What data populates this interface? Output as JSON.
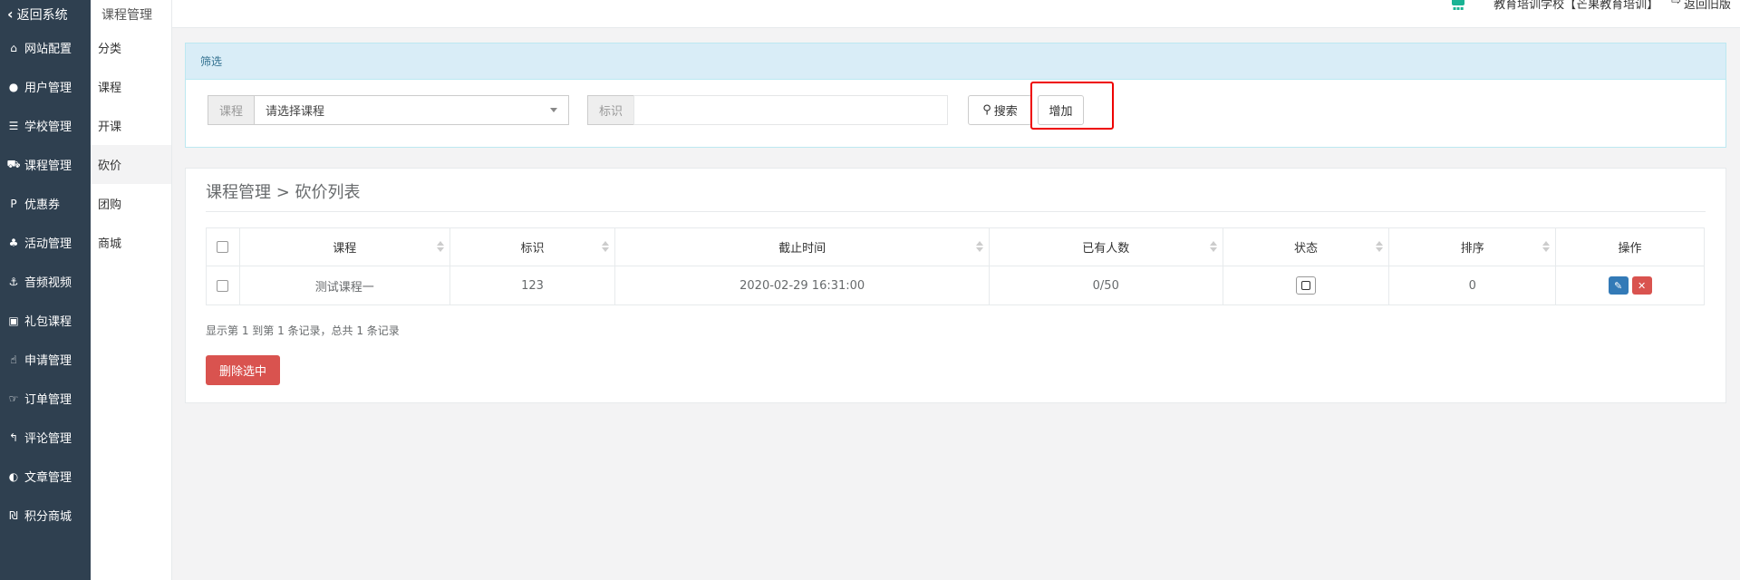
{
  "sidebar": {
    "back_label": "返回系统",
    "items": [
      {
        "icon": "home-icon",
        "glyph": "⌂",
        "label": "网站配置"
      },
      {
        "icon": "user-icon",
        "glyph": "●",
        "label": "用户管理"
      },
      {
        "icon": "server-icon",
        "glyph": "☰",
        "label": "学校管理"
      },
      {
        "icon": "cart-icon",
        "glyph": "⛟",
        "label": "课程管理"
      },
      {
        "icon": "ticket-icon",
        "glyph": "P",
        "label": "优惠券"
      },
      {
        "icon": "users-icon",
        "glyph": "♣",
        "label": "活动管理"
      },
      {
        "icon": "anchor-icon",
        "glyph": "⚓",
        "label": "音频视频"
      },
      {
        "icon": "gift-icon",
        "glyph": "▣",
        "label": "礼包课程"
      },
      {
        "icon": "hand-pointer-icon",
        "glyph": "☝",
        "label": "申请管理"
      },
      {
        "icon": "thumbs-up-icon",
        "glyph": "☞",
        "label": "订单管理"
      },
      {
        "icon": "reply-icon",
        "glyph": "↰",
        "label": "评论管理"
      },
      {
        "icon": "adjust-icon",
        "glyph": "◐",
        "label": "文章管理"
      },
      {
        "icon": "ils-icon",
        "glyph": "₪",
        "label": "积分商城"
      }
    ]
  },
  "subbar": {
    "title": "课程管理",
    "items": [
      "分类",
      "课程",
      "开课",
      "砍价",
      "团购",
      "商城"
    ]
  },
  "topbar": {
    "school": "教育培训学校【芒果教育培训】",
    "exit_label": "返回旧版"
  },
  "filter": {
    "title": "筛选",
    "course_label": "课程",
    "course_placeholder": "请选择课程",
    "tag_label": "标识",
    "search_label": "搜索",
    "add_label": "增加"
  },
  "list": {
    "breadcrumb": "课程管理 > 砍价列表",
    "columns": [
      "课程",
      "标识",
      "截止时间",
      "已有人数",
      "状态",
      "排序",
      "操作"
    ],
    "rows": [
      {
        "course": "测试课程一",
        "tag": "123",
        "deadline": "2020-02-29 16:31:00",
        "count": "0/50",
        "sort": "0"
      }
    ],
    "record_info": "显示第 1 到第 1 条记录，总共 1 条记录",
    "delete_selected": "删除选中"
  },
  "colors": {
    "sidebar_bg": "#2f4050",
    "primary": "#337ab7",
    "danger": "#d9534f",
    "info_bg": "#d9edf7",
    "highlight": "#e00000"
  }
}
